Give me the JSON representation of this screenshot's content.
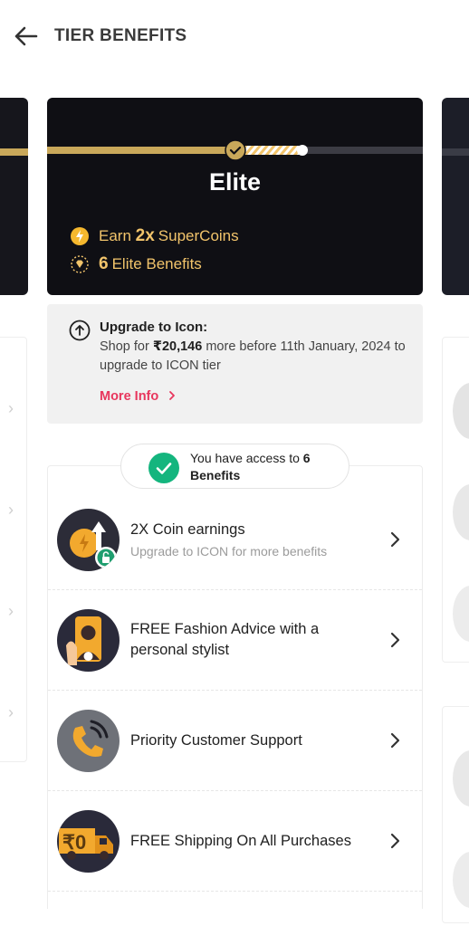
{
  "header": {
    "title": "TIER BENEFITS",
    "back_icon": "back-arrow-icon"
  },
  "tier": {
    "name": "Elite",
    "perk1_prefix": "Earn",
    "perk1_mult": "2x",
    "perk1_suffix": "SuperCoins",
    "perk2_count": "6",
    "perk2_suffix": "Elite Benefits"
  },
  "upgrade": {
    "title": "Upgrade to Icon:",
    "text_prefix": "Shop for",
    "amount": "₹20,146",
    "text_suffix": "more before 11th January, 2024 to upgrade to ICON tier",
    "more_info": "More Info"
  },
  "access": {
    "prefix": "You have access to",
    "count": "6",
    "suffix": "Benefits"
  },
  "benefits": [
    {
      "label": "2X Coin earnings",
      "sub": "Upgrade to ICON for more benefits"
    },
    {
      "label": "FREE Fashion Advice with a personal stylist",
      "sub": ""
    },
    {
      "label": "Priority Customer Support",
      "sub": ""
    },
    {
      "label": "FREE Shipping On All Purchases",
      "sub": ""
    }
  ],
  "colors": {
    "gold": "#f2c46b",
    "accent_pink": "#e8365d",
    "check_green": "#14b57e",
    "card_dark": "#0f0f14"
  }
}
